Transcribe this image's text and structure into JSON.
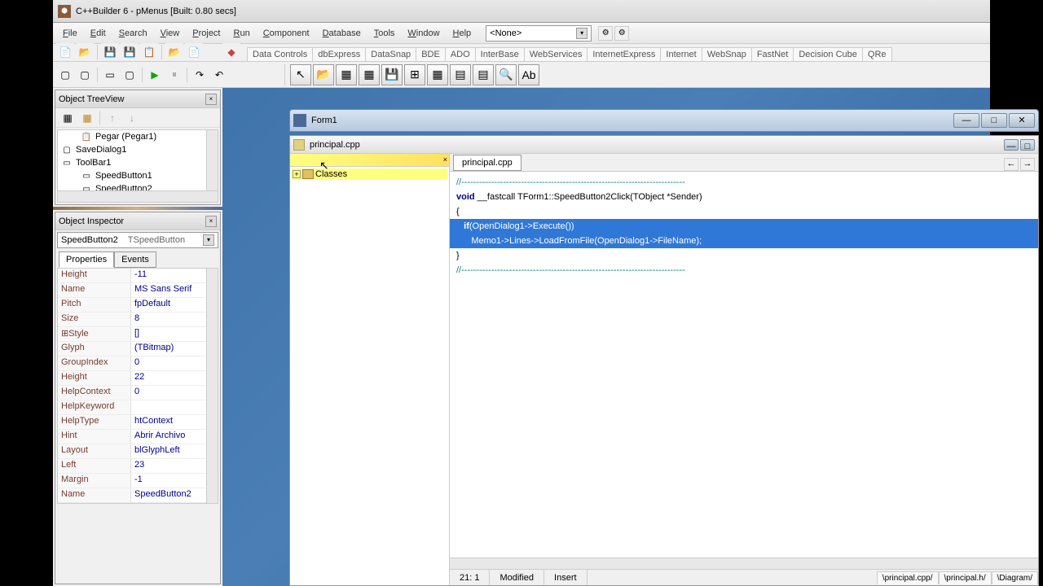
{
  "title": "C++Builder 6 - pMenus [Built: 0.80 secs]",
  "menubar": [
    "File",
    "Edit",
    "Search",
    "View",
    "Project",
    "Run",
    "Component",
    "Database",
    "Tools",
    "Window",
    "Help"
  ],
  "library_combo": "<None>",
  "palette_tabs": [
    "Data Controls",
    "dbExpress",
    "DataSnap",
    "BDE",
    "ADO",
    "InterBase",
    "WebServices",
    "InternetExpress",
    "Internet",
    "WebSnap",
    "FastNet",
    "Decision Cube",
    "QRe"
  ],
  "treeview": {
    "title": "Object TreeView",
    "items": [
      {
        "indent": 1,
        "icon": "paste",
        "label": "Pegar (Pegar1)"
      },
      {
        "indent": 0,
        "icon": "dialog",
        "label": "SaveDialog1"
      },
      {
        "indent": 0,
        "icon": "toolbar",
        "label": "ToolBar1"
      },
      {
        "indent": 1,
        "icon": "button",
        "label": "SpeedButton1"
      },
      {
        "indent": 1,
        "icon": "button",
        "label": "SpeedButton2"
      }
    ]
  },
  "inspector": {
    "title": "Object Inspector",
    "object": "SpeedButton2",
    "class": "TSpeedButton",
    "tabs": [
      "Properties",
      "Events"
    ],
    "props": [
      {
        "name": "Height",
        "val": "-11"
      },
      {
        "name": "Name",
        "val": "MS Sans Serif"
      },
      {
        "name": "Pitch",
        "val": "fpDefault"
      },
      {
        "name": "Size",
        "val": "8"
      },
      {
        "name": "⊞Style",
        "val": "[]"
      },
      {
        "name": "Glyph",
        "val": "(TBitmap)"
      },
      {
        "name": "GroupIndex",
        "val": "0"
      },
      {
        "name": "Height",
        "val": "22"
      },
      {
        "name": "HelpContext",
        "val": "0"
      },
      {
        "name": "HelpKeyword",
        "val": ""
      },
      {
        "name": "HelpType",
        "val": "htContext"
      },
      {
        "name": "Hint",
        "val": "Abrir Archivo"
      },
      {
        "name": "Layout",
        "val": "blGlyphLeft"
      },
      {
        "name": "Left",
        "val": "23"
      },
      {
        "name": "Margin",
        "val": "-1"
      },
      {
        "name": "Name",
        "val": "SpeedButton2"
      }
    ]
  },
  "form": {
    "title": "Form1"
  },
  "editor": {
    "file": "principal.cpp",
    "class_root": "Classes",
    "tab": "principal.cpp",
    "code": {
      "l1": "//---------------------------------------------------------------------------",
      "l2a": "void",
      "l2b": " __fastcall TForm1::SpeedButton2Click(TObject *Sender)",
      "l3": "{",
      "l4a": "   if",
      "l4b": "(OpenDialog1->Execute())",
      "l5": "      Memo1->Lines->LoadFromFile(OpenDialog1->FileName);",
      "l6": "}",
      "l7": "//---------------------------------------------------------------------------"
    }
  },
  "status": {
    "pos": "   21:    1",
    "modified": "Modified",
    "insert": "Insert",
    "tabs": [
      "principal.cpp",
      "principal.h",
      "Diagram"
    ]
  }
}
